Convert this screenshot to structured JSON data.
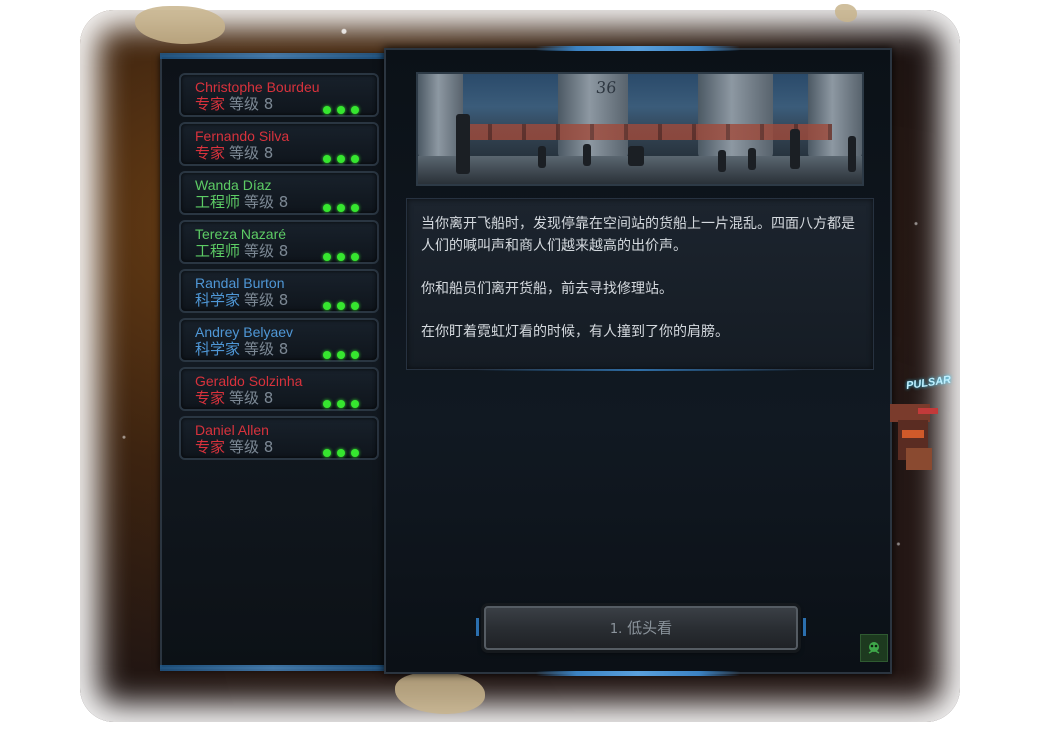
{
  "crew": [
    {
      "name": "Christophe Bourdeu",
      "role": "专家",
      "level": "等级 8",
      "color": "#d8323c"
    },
    {
      "name": "Fernando Silva",
      "role": "专家",
      "level": "等级 8",
      "color": "#d8323c"
    },
    {
      "name": "Wanda Díaz",
      "role": "工程师",
      "level": "等级 8",
      "color": "#5dcc65"
    },
    {
      "name": "Tereza Nazaré",
      "role": "工程师",
      "level": "等级 8",
      "color": "#5dcc65"
    },
    {
      "name": "Randal Burton",
      "role": "科学家",
      "level": "等级 8",
      "color": "#4f97d6"
    },
    {
      "name": "Andrey Belyaev",
      "role": "科学家",
      "level": "等级 8",
      "color": "#4f97d6"
    },
    {
      "name": "Geraldo Solzinha",
      "role": "专家",
      "level": "等级 8",
      "color": "#d8323c"
    },
    {
      "name": "Daniel Allen",
      "role": "专家",
      "level": "等级 8",
      "color": "#d8323c"
    }
  ],
  "scene": {
    "label": "36"
  },
  "story": {
    "paragraphs": [
      "当你离开飞船时，发现停靠在空间站的货船上一片混乱。四面八方都是人们的喊叫声和商人们越来越高的出价声。",
      "你和船员们离开货船，前去寻找修理站。",
      "在你盯着霓虹灯看的时候，有人撞到了你的肩膀。"
    ]
  },
  "choices": [
    {
      "number": "1.",
      "label": "低头看"
    }
  ],
  "ship_label": "PULSAR",
  "colors": {
    "specialist": "#d8323c",
    "engineer": "#5dcc65",
    "scientist": "#4f97d6",
    "status_dot": "#36e62f",
    "accent_blue": "#3b82c2"
  },
  "icons": {
    "corner": "alien-icon"
  }
}
